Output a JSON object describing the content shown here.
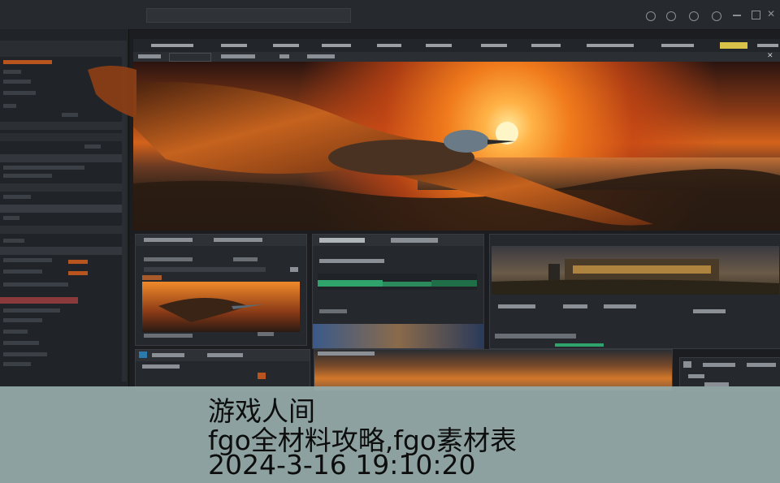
{
  "caption": {
    "line1": "游戏人间",
    "line2": "fgo全材料攻略,fgo素材表",
    "line3": "2024-3-16 19:10:20"
  },
  "colors": {
    "caption_bg": "#96acaa",
    "accent_orange": "#f07a1c",
    "highlight_yellow": "#d9c24a",
    "graph_green": "#2fa36b"
  }
}
